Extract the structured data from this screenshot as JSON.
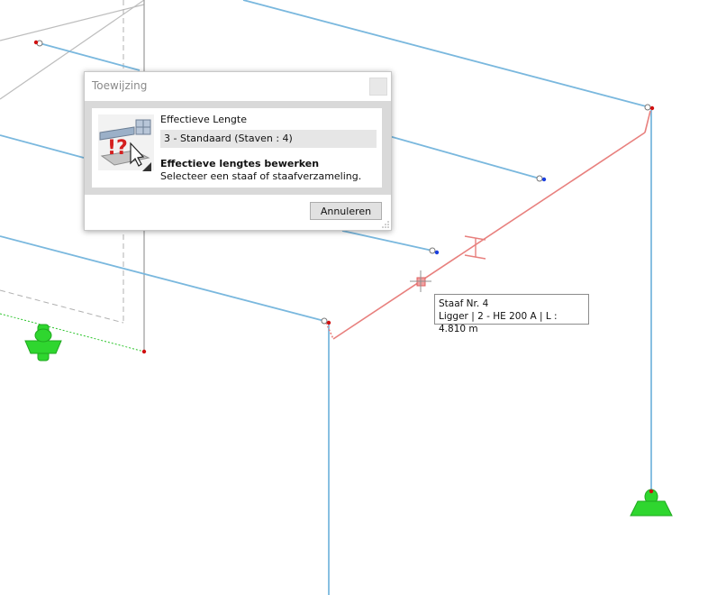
{
  "dialog": {
    "title": "Toewijzing",
    "heading": "Effectieve Lengte",
    "selection": "3 - Standaard (Staven : 4)",
    "instruction_bold": "Effectieve lengtes bewerken",
    "instruction_text": "Selecteer een staaf of staafverzameling.",
    "cancel_label": "Annuleren"
  },
  "tooltip": {
    "line1": "Staaf Nr. 4",
    "line2": "Ligger | 2 - HE 200 A | L : 4.810 m"
  },
  "colors": {
    "member_blue": "#7ab8de",
    "selected_red": "#e8807e",
    "support_green": "#2fd62f",
    "node_red": "#d01010",
    "node_blue": "#1a3fe0"
  }
}
